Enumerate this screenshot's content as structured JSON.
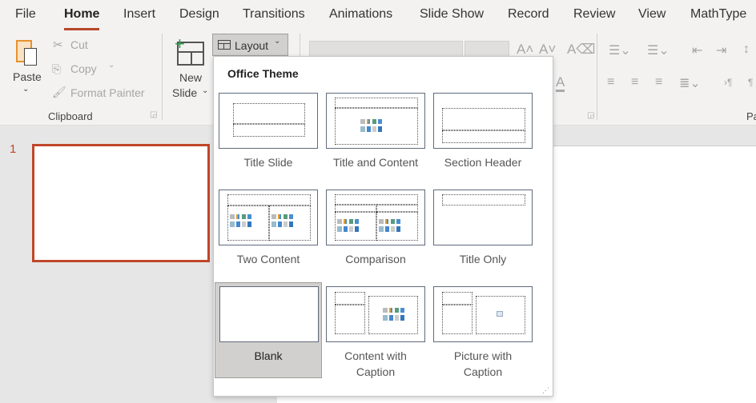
{
  "tabs": [
    "File",
    "Home",
    "Insert",
    "Design",
    "Transitions",
    "Animations",
    "Slide Show",
    "Record",
    "Review",
    "View",
    "MathType"
  ],
  "active_tab": "Home",
  "clipboard": {
    "paste": "Paste",
    "cut": "Cut",
    "copy": "Copy",
    "format_painter": "Format Painter",
    "group": "Clipboard"
  },
  "slides": {
    "new_slide_line1": "New",
    "new_slide_line2": "Slide",
    "layout": "Layout"
  },
  "paragraph_group_partial": "Pa",
  "slide_pane": {
    "number": "1"
  },
  "layout_menu": {
    "theme": "Office Theme",
    "selected": "Blank",
    "items": [
      {
        "label": "Title Slide"
      },
      {
        "label": "Title and Content"
      },
      {
        "label": "Section Header"
      },
      {
        "label": "Two Content"
      },
      {
        "label": "Comparison"
      },
      {
        "label": "Title Only"
      },
      {
        "label": "Blank"
      },
      {
        "label": "Content with Caption"
      },
      {
        "label": "Picture with Caption"
      }
    ]
  },
  "colors": {
    "accent": "#b7472a",
    "selected_bg": "#d2d0ce"
  }
}
